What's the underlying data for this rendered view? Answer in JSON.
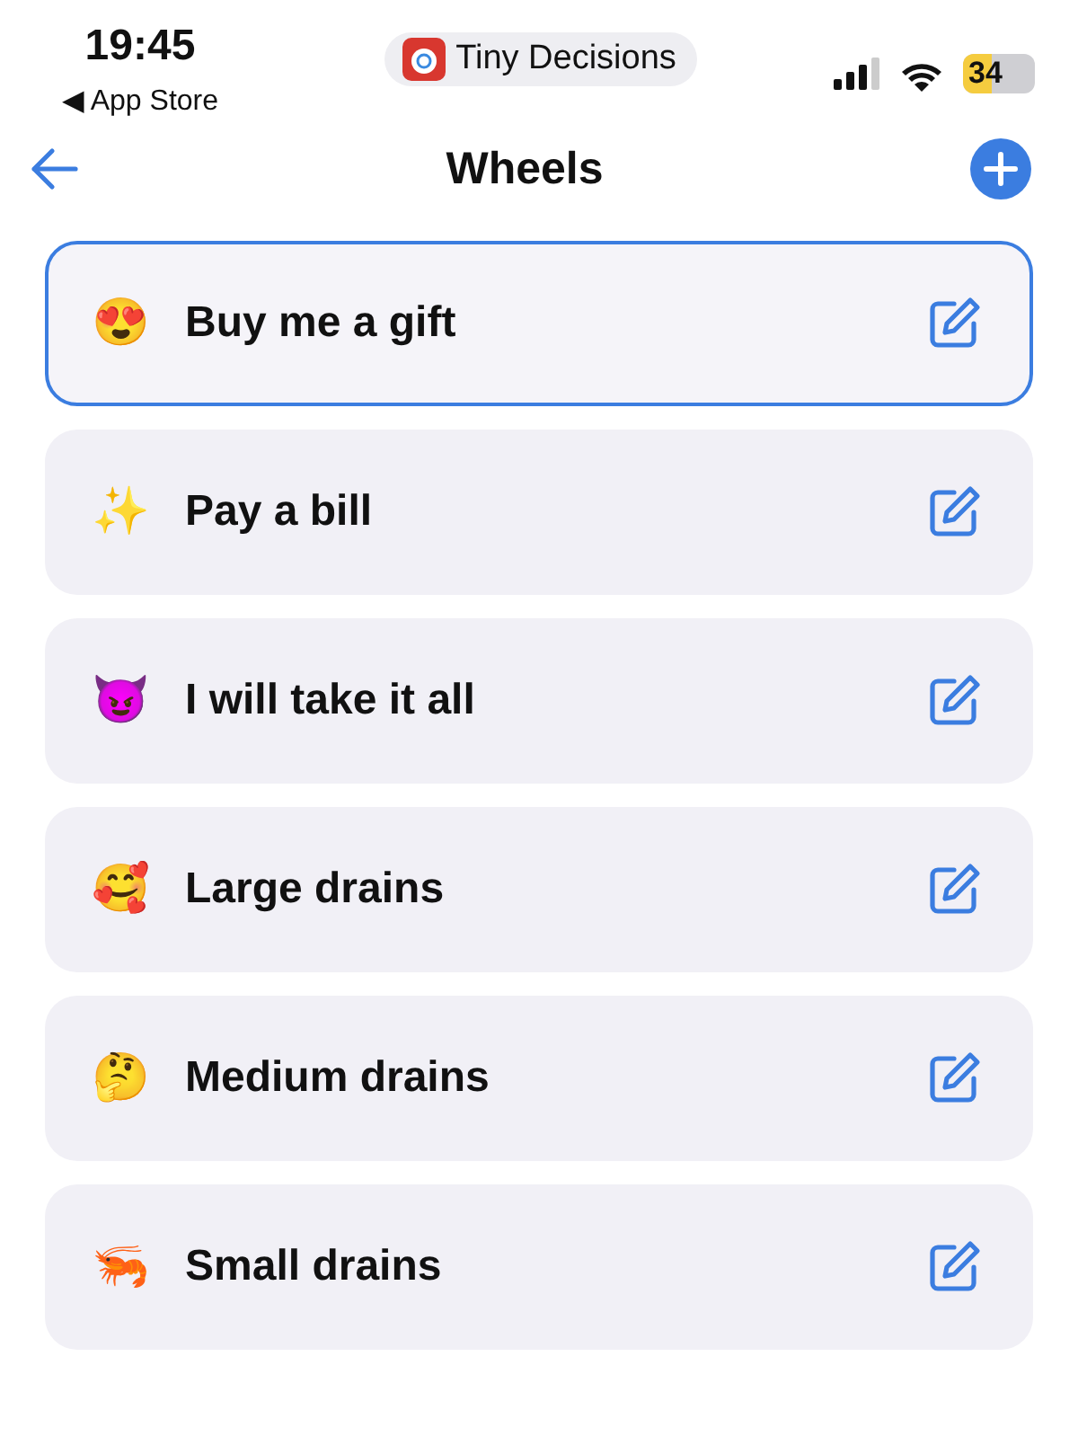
{
  "status_bar": {
    "time": "19:45",
    "back_app": "◀ App Store",
    "app_pill": "Tiny Decisions",
    "battery": "34"
  },
  "nav": {
    "title": "Wheels"
  },
  "wheels": [
    {
      "emoji": "😍",
      "name": "Buy me a gift",
      "selected": true
    },
    {
      "emoji": "✨",
      "name": "Pay a bill",
      "selected": false
    },
    {
      "emoji": "😈",
      "name": "I will take it all",
      "selected": false
    },
    {
      "emoji": "🥰",
      "name": "Large drains",
      "selected": false
    },
    {
      "emoji": "🤔",
      "name": "Medium drains",
      "selected": false
    },
    {
      "emoji": "🦐",
      "name": "Small drains",
      "selected": false
    }
  ]
}
